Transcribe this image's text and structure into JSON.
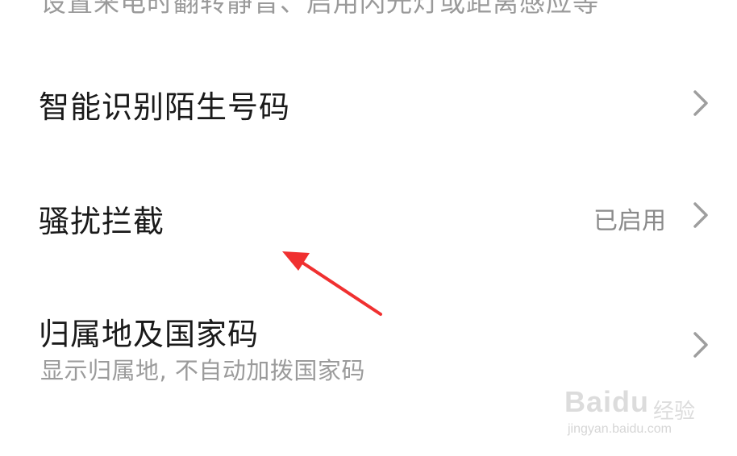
{
  "top_partial_text": "设置来电时翻转静音、启用闪光灯或距离感应等",
  "rows": [
    {
      "title": "智能识别陌生号码"
    },
    {
      "title": "骚扰拦截",
      "value": "已启用"
    },
    {
      "title": "归属地及国家码",
      "subtitle": "显示归属地, 不自动加拨国家码"
    }
  ],
  "annotation": {
    "arrow_color": "#f03030"
  },
  "watermark": {
    "brand": "Baidu",
    "brand_cn": "经验",
    "url": "jingyan.baidu.com"
  },
  "icons": {
    "chevron": "chevron-right-icon",
    "arrow": "red-arrow-annotation"
  }
}
